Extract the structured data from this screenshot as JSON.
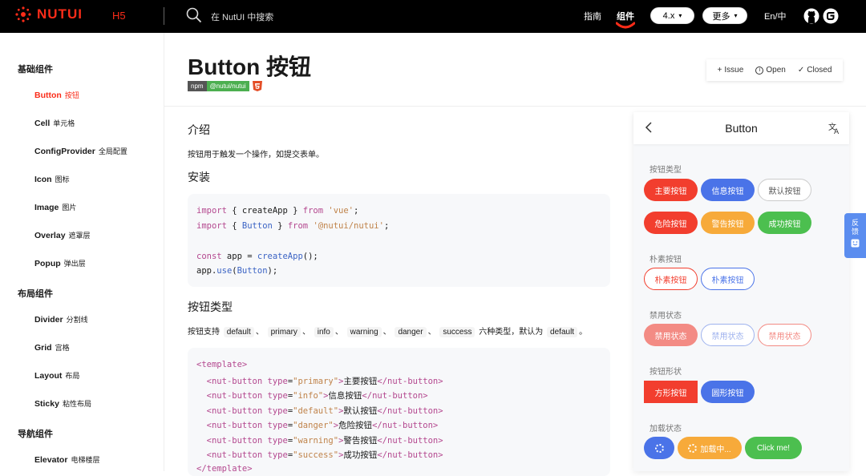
{
  "header": {
    "logo_text": "NUTUI",
    "h5_tag": "H5",
    "search_placeholder": "在 NutUI 中搜索",
    "nav": [
      "指南",
      "组件"
    ],
    "version_select": "4.x",
    "more_select": "更多",
    "lang": "En/中",
    "colors": {
      "brand": "#fa2c19",
      "bg": "#000000"
    }
  },
  "sidebar": {
    "groups": [
      {
        "title": "基础组件",
        "items": [
          {
            "en": "Button",
            "zh": "按钮",
            "active": true
          },
          {
            "en": "Cell",
            "zh": "单元格"
          },
          {
            "en": "ConfigProvider",
            "zh": "全局配置"
          },
          {
            "en": "Icon",
            "zh": "图标"
          },
          {
            "en": "Image",
            "zh": "图片"
          },
          {
            "en": "Overlay",
            "zh": "遮罩层"
          },
          {
            "en": "Popup",
            "zh": "弹出层"
          }
        ]
      },
      {
        "title": "布局组件",
        "items": [
          {
            "en": "Divider",
            "zh": "分割线"
          },
          {
            "en": "Grid",
            "zh": "宫格"
          },
          {
            "en": "Layout",
            "zh": "布局"
          },
          {
            "en": "Sticky",
            "zh": "粘性布局"
          }
        ]
      },
      {
        "title": "导航组件",
        "items": [
          {
            "en": "Elevator",
            "zh": "电梯楼层"
          }
        ]
      }
    ]
  },
  "doc": {
    "title": "Button 按钮",
    "badge_npm": "npm",
    "badge_pkg": "@nutui/nutui",
    "issue": {
      "issue": "Issue",
      "open": "Open",
      "closed": "Closed"
    },
    "intro_heading": "介绍",
    "intro_text": "按钮用于触发一个操作，如提交表单。",
    "install_heading": "安装",
    "install_code": [
      "import { createApp } from 'vue';",
      "import { Button } from '@nutui/nutui';",
      "",
      "const app = createApp();",
      "app.use(Button);"
    ],
    "types_heading": "按钮类型",
    "types_text_prefix": "按钮支持",
    "types_list": [
      "default",
      "primary",
      "info",
      "warning",
      "danger",
      "success"
    ],
    "types_sep": "、",
    "types_text_suffix": "六种类型，默认为",
    "types_default": "default",
    "types_end": "。",
    "template_code": [
      "<template>",
      "  <nut-button type=\"primary\">主要按钮</nut-button>",
      "  <nut-button type=\"info\">信息按钮</nut-button>",
      "  <nut-button type=\"default\">默认按钮</nut-button>",
      "  <nut-button type=\"danger\">危险按钮</nut-button>",
      "  <nut-button type=\"warning\">警告按钮</nut-button>",
      "  <nut-button type=\"success\">成功按钮</nut-button>",
      "</template>"
    ]
  },
  "demo": {
    "title": "Button",
    "sections": {
      "types": "按钮类型",
      "plain": "朴素按钮",
      "disabled": "禁用状态",
      "shape": "按钮形状",
      "loading": "加载状态"
    },
    "buttons": {
      "primary": "主要按钮",
      "info": "信息按钮",
      "default": "默认按钮",
      "danger": "危险按钮",
      "warning": "警告按钮",
      "success": "成功按钮",
      "plain": "朴素按钮",
      "disabled": "禁用状态",
      "square": "方形按钮",
      "round": "圆形按钮",
      "loading": "加载中...",
      "click": "Click me!"
    }
  },
  "feedback": {
    "line1": "反",
    "line2": "馈"
  }
}
